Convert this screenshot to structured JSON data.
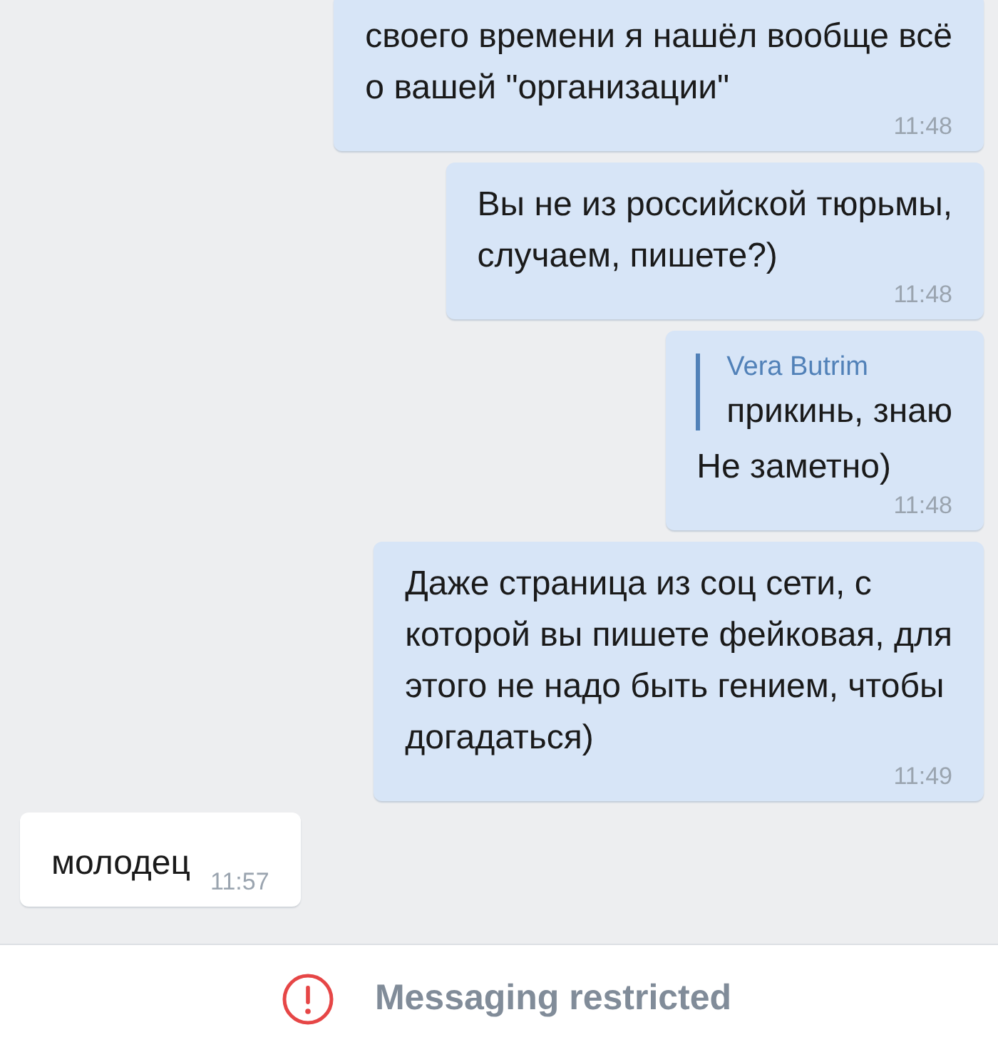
{
  "messages": [
    {
      "kind": "outgoing",
      "text": "своего времени я нашёл вообще всё\nо вашей \"организации\"",
      "time": "11:48"
    },
    {
      "kind": "outgoing",
      "text": "Вы не из российской тюрьмы,\nслучаем, пишете?)",
      "time": "11:48"
    },
    {
      "kind": "outgoing",
      "quote": {
        "author": "Vera Butrim",
        "text": "прикинь, знаю"
      },
      "text": "Не заметно)",
      "time": "11:48"
    },
    {
      "kind": "outgoing",
      "text": "Даже страница из соц сети, с\nкоторой вы пишете фейковая, для\nэтого не надо быть гением, чтобы\nдогадаться)",
      "time": "11:49"
    },
    {
      "kind": "incoming",
      "text": "молодец",
      "time": "11:57"
    }
  ],
  "footer": {
    "notice": "Messaging restricted"
  }
}
